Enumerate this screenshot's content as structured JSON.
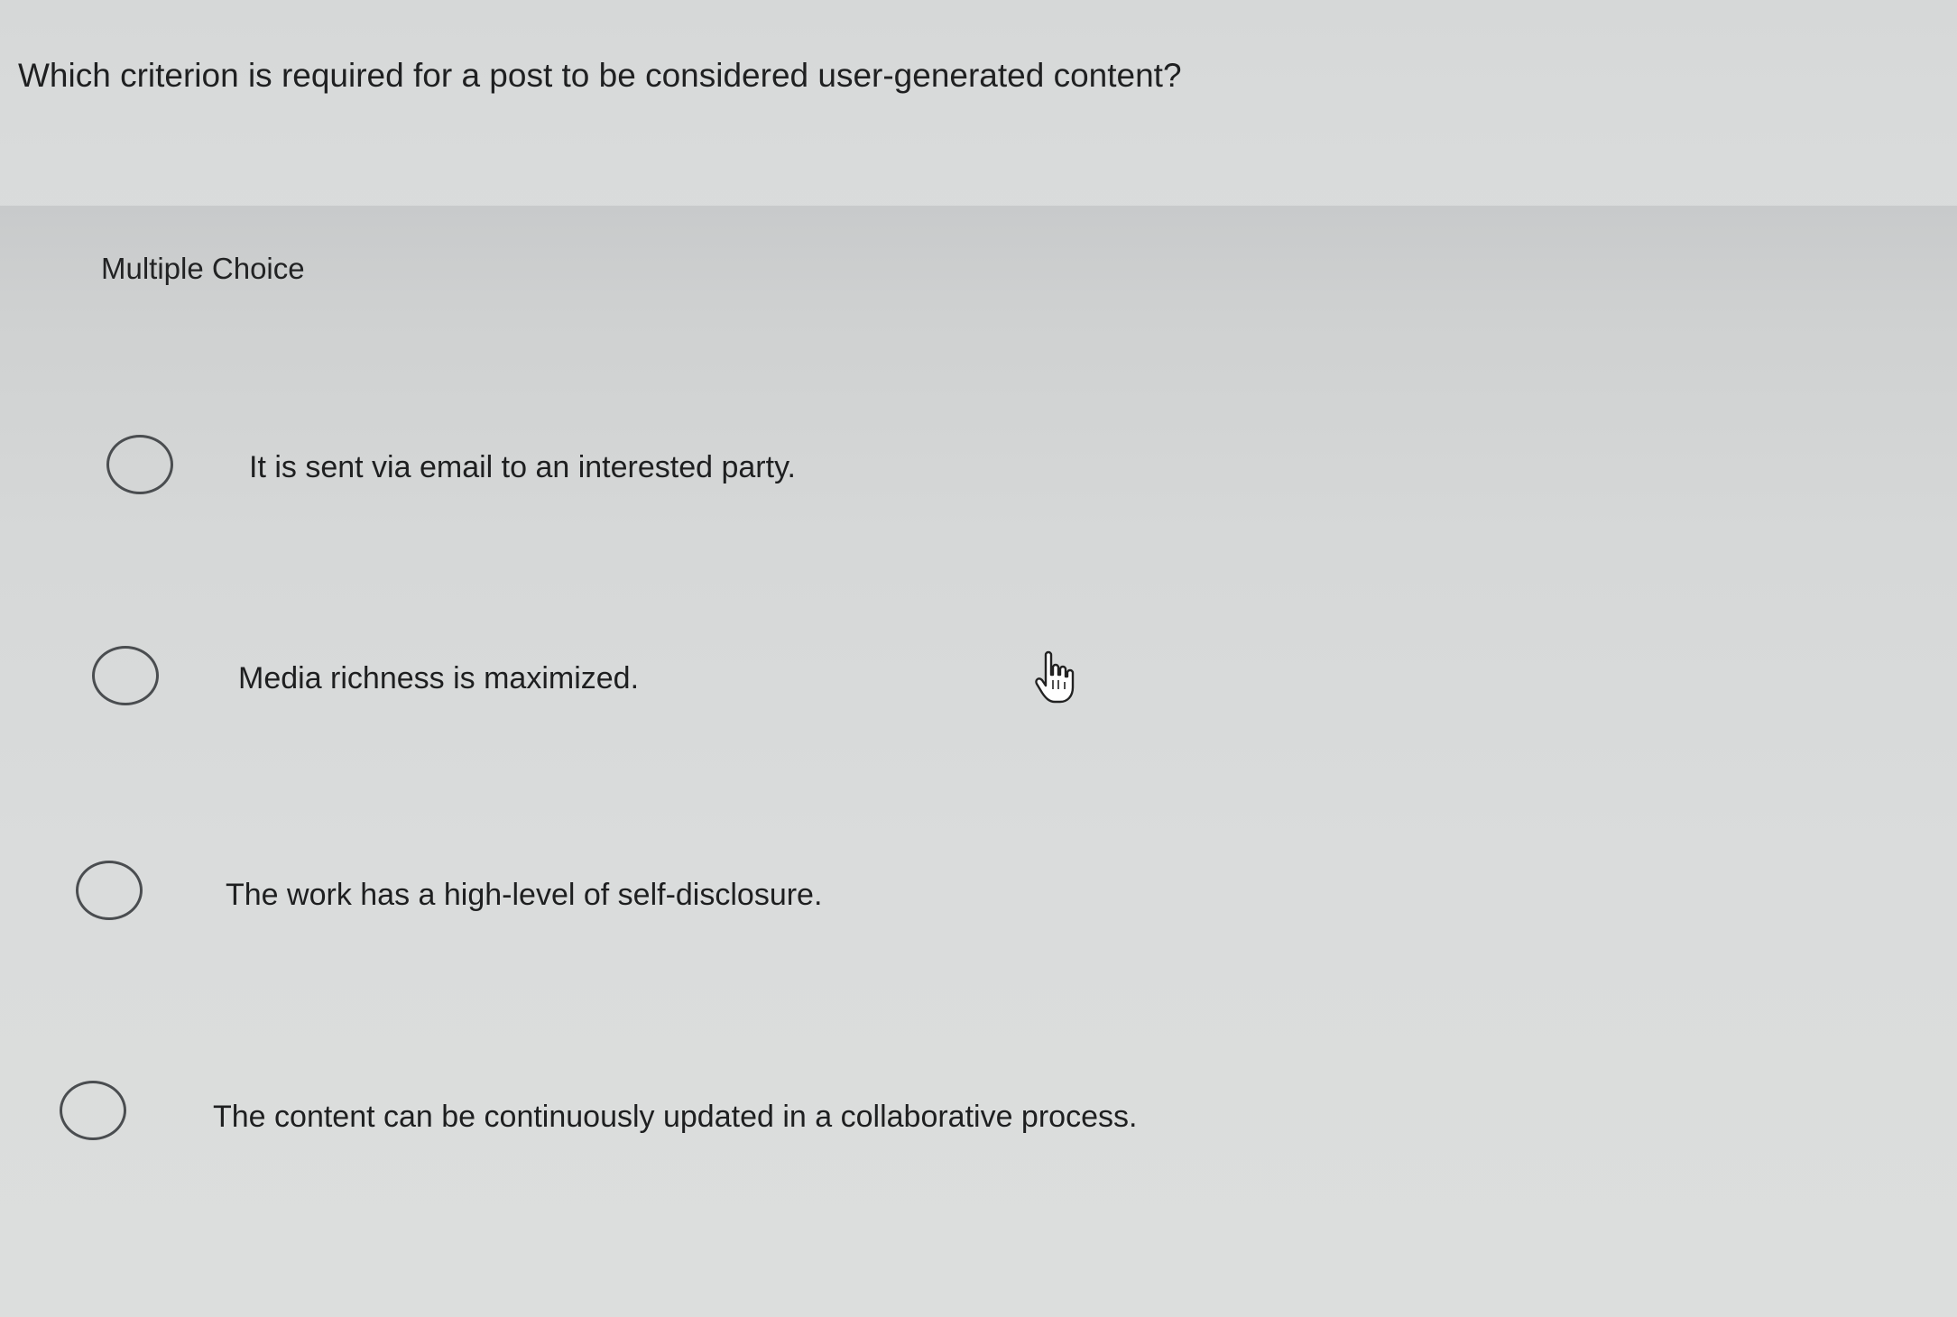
{
  "question": {
    "text": "Which criterion is required for a post to be considered user-generated content?"
  },
  "multiple_choice": {
    "header": "Multiple Choice",
    "options": [
      {
        "label": "It is sent via email to an interested party.",
        "selected": false
      },
      {
        "label": "Media richness is maximized.",
        "selected": false
      },
      {
        "label": "The work has a high-level of self-disclosure.",
        "selected": false
      },
      {
        "label": "The content can be continuously updated in a collaborative process.",
        "selected": false
      }
    ]
  },
  "cursor": {
    "icon": "hand-pointer-icon"
  }
}
